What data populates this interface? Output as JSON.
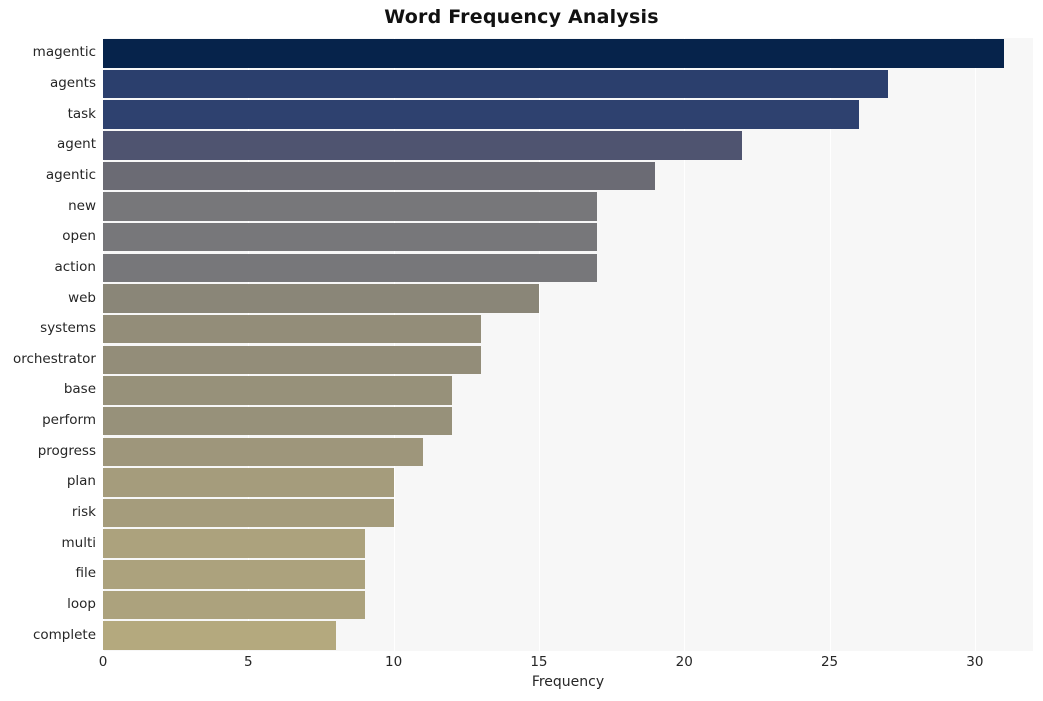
{
  "chart_data": {
    "type": "bar",
    "orientation": "horizontal",
    "title": "Word Frequency Analysis",
    "xlabel": "Frequency",
    "ylabel": "",
    "xlim": [
      0,
      32
    ],
    "xticks": [
      0,
      5,
      10,
      15,
      20,
      25,
      30
    ],
    "grid": "vertical",
    "legend": "none",
    "categories": [
      "magentic",
      "agents",
      "task",
      "agent",
      "agentic",
      "new",
      "open",
      "action",
      "web",
      "systems",
      "orchestrator",
      "base",
      "perform",
      "progress",
      "plan",
      "risk",
      "multi",
      "file",
      "loop",
      "complete"
    ],
    "values": [
      31,
      27,
      26,
      22,
      19,
      17,
      17,
      17,
      15,
      13,
      13,
      12,
      12,
      11,
      10,
      10,
      9,
      9,
      9,
      8
    ],
    "bar_colors": [
      "#06234b",
      "#2b3f6d",
      "#2e416f",
      "#4f5470",
      "#6b6b74",
      "#77777a",
      "#77777a",
      "#77777a",
      "#8a8678",
      "#938d79",
      "#938d79",
      "#97917a",
      "#97917a",
      "#9e967b",
      "#a59c7c",
      "#a59c7c",
      "#aca27d",
      "#aca27d",
      "#aca27d",
      "#b4a97e"
    ],
    "plot_background": "#f7f7f7",
    "gridline_color": "#ffffff"
  }
}
